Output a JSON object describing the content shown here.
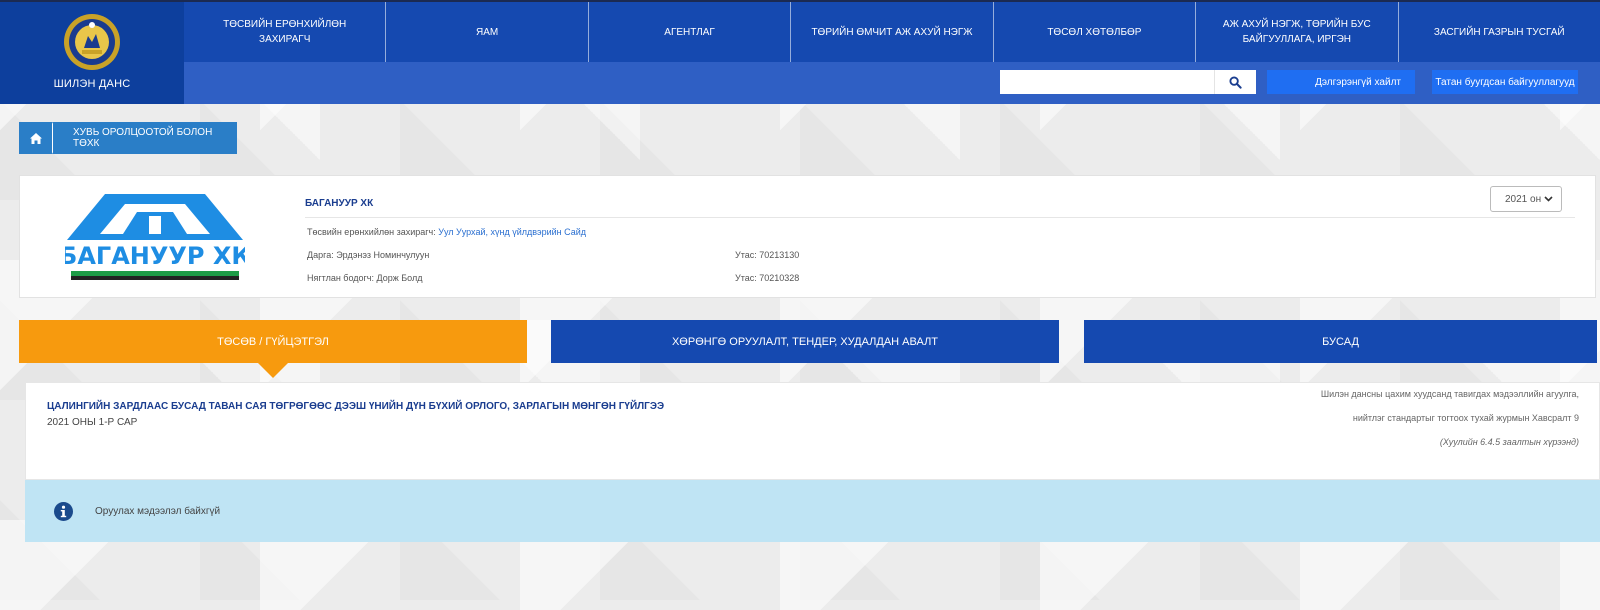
{
  "brand": {
    "title": "ШИЛЭН ДАНС"
  },
  "nav": {
    "items": [
      "ТӨСВИЙН ЕРӨНХИЙЛӨН ЗАХИРАГЧ",
      "ЯАМ",
      "АГЕНТЛАГ",
      "ТӨРИЙН ӨМЧИТ АЖ АХУЙ НЭГЖ",
      "ТӨСӨЛ ХӨТӨЛБӨР",
      "АЖ АХУЙ НЭГЖ, ТӨРИЙН БУС БАЙГУУЛЛАГА, ИРГЭН",
      "ЗАСГИЙН ГАЗРЫН ТУСГАЙ"
    ]
  },
  "search": {
    "placeholder": "",
    "value": ""
  },
  "toolbar": {
    "advanced_search_label": "Дэлгэрэнгүй хайлт",
    "download_orgs_label": "Татан буугдсан байгууллагууд"
  },
  "breadcrumb": {
    "label": "ХУВЬ ОРОЛЦООТОЙ БОЛОН ТӨХК"
  },
  "org": {
    "logo_text": "БАГАНУУР ХК",
    "name": "БАГАНУУР ХК",
    "manager_label": "Төсвийн ерөнхийлөн захирагч:",
    "manager_link": "Уул Уурхай, хүнд үйлдвэрийн Сайд",
    "director": "Дарга: Эрдэнэз Номинчулуун",
    "director_phone": "Утас: 70213130",
    "accountant": "Нягтлан бодогч: Дорж Болд",
    "accountant_phone": "Утас: 70210328",
    "year_select": "2021 он"
  },
  "tabs": [
    {
      "label": "ТӨСӨВ / ГҮЙЦЭТГЭЛ",
      "active": true
    },
    {
      "label": "ХӨРӨНГӨ ОРУУЛАЛТ, ТЕНДЕР, ХУДАЛДАН АВАЛТ",
      "active": false
    },
    {
      "label": "БУСАД",
      "active": false
    }
  ],
  "report": {
    "title": "ЦАЛИНГИЙН ЗАРДЛААС БУСАД ТАВАН САЯ ТӨГРӨГӨӨС ДЭЭШ ҮНИЙН ДҮН БҮХИЙ ОРЛОГО, ЗАРЛАГЫН МӨНГӨН ГҮЙЛГЭЭ",
    "subtitle": "2021 ОНЫ 1-Р САР",
    "note_line1": "Шилэн дансны цахим хуудсанд тавигдах мэдээллийн агуулга,",
    "note_line2": "нийтлэг стандартыг тогтоох тухай журмын Хавсралт 9",
    "note_line3": "(Хуулийн 6.4.5 заалтын хүрээнд)"
  },
  "alert": {
    "text": "Оруулах мэдээлэл байхгүй"
  },
  "colors": {
    "nav_blue": "#1549b0",
    "brand_blue": "#0d3f9d",
    "active_tab": "#f79a0e",
    "alert_bg": "#bfe4f4"
  }
}
